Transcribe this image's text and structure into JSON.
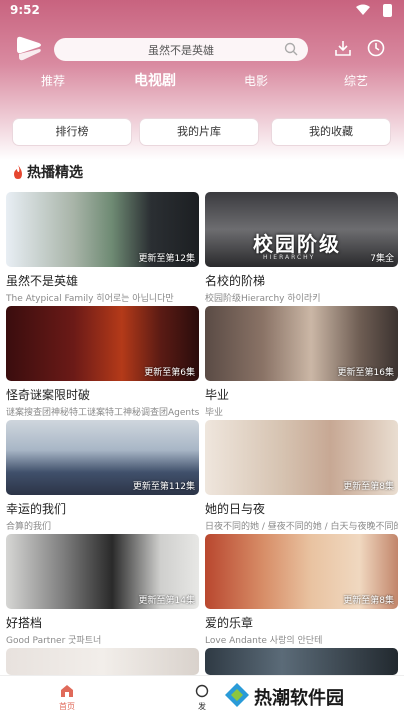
{
  "status": {
    "time": "9:52"
  },
  "search": {
    "placeholder": "虽然不是英雄"
  },
  "tabs": [
    {
      "label": "推荐"
    },
    {
      "label": "电视剧",
      "active": true
    },
    {
      "label": "电影"
    },
    {
      "label": "综艺"
    }
  ],
  "quick_buttons": [
    {
      "label": "排行榜"
    },
    {
      "label": "我的片库"
    },
    {
      "label": "我的收藏"
    }
  ],
  "section": {
    "title": "热播精选"
  },
  "cards": [
    {
      "title": "虽然不是英雄",
      "subtitle": "The Atypical Family 히어로는 아닙니다만",
      "badge": "更新至第12集"
    },
    {
      "title": "名校的阶梯",
      "subtitle": "校园阶级Hierarchy 하이라키",
      "badge": "7集全",
      "poster_text": "校园阶级",
      "poster_sub": "HIERARCHY"
    },
    {
      "title": "怪奇谜案限时破",
      "subtitle": "谜案搜查团神秘特工谜案特工神秘调查团Agents of M",
      "badge": "更新至第6集"
    },
    {
      "title": "毕业",
      "subtitle": "毕业",
      "badge": "更新至第16集"
    },
    {
      "title": "幸运的我们",
      "subtitle": "合算的我们",
      "badge": "更新至第112集"
    },
    {
      "title": "她的日与夜",
      "subtitle": "日夜不同的她 / 昼夜不同的她 / 白天与夜晚不同的她 / Mi",
      "badge": "更新至第8集"
    },
    {
      "title": "好搭档",
      "subtitle": "Good Partner 굿파트너",
      "badge": "更新至第14集"
    },
    {
      "title": "爱的乐章",
      "subtitle": "Love Andante 사랑의 안단테",
      "badge": "更新至第8集"
    }
  ],
  "bottom_nav": {
    "home_label": "首页",
    "discover_label": "发"
  },
  "watermark": {
    "text": "热潮软件园"
  },
  "colors": {
    "accent": "#c8637f",
    "nav_active": "#e06a5a"
  }
}
